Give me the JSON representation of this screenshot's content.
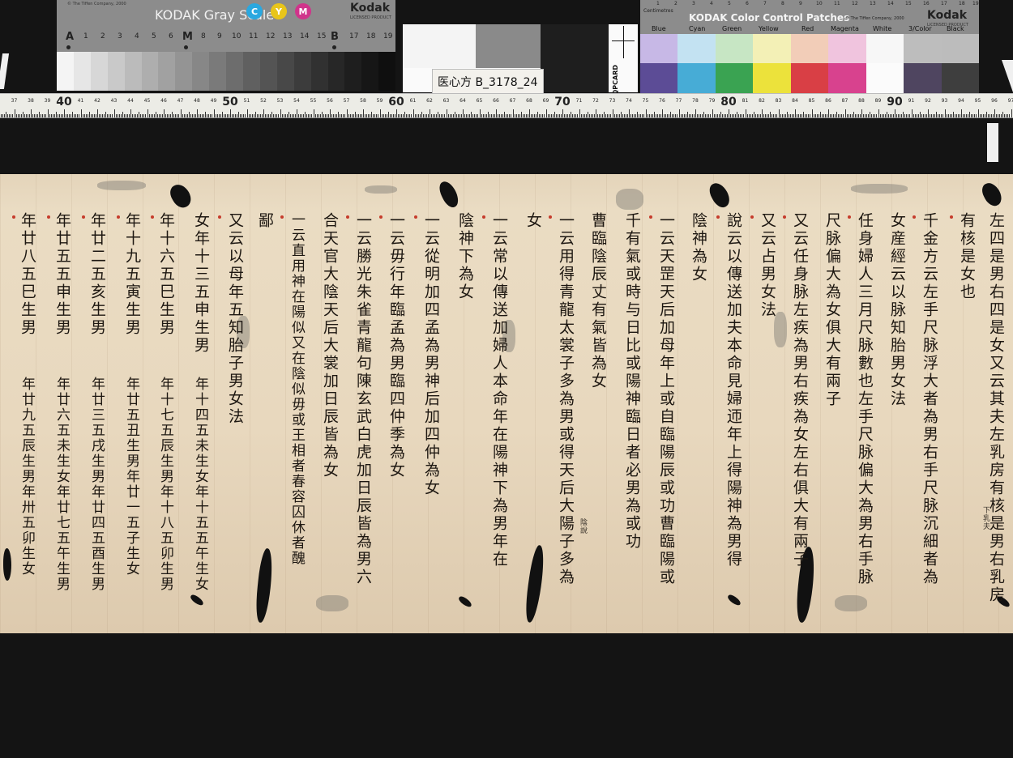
{
  "gray_card": {
    "copyright": "© The Tiffen Company, 2000",
    "title": "KODAK Gray Scale",
    "cym": [
      "C",
      "Y",
      "M"
    ],
    "brand": "Kodak",
    "brand_sub": "LICENSED PRODUCT",
    "scale": [
      "A",
      "1",
      "2",
      "3",
      "4",
      "5",
      "6",
      "M",
      "8",
      "9",
      "10",
      "11",
      "12",
      "13",
      "14",
      "15",
      "B",
      "17",
      "18",
      "19"
    ]
  },
  "label_card": {
    "label": "医心方 B_3178_24",
    "qpcard": "QPCARD"
  },
  "color_card": {
    "cm_label": "Centimetres",
    "cm_ticks": [
      "1",
      "2",
      "3",
      "4",
      "5",
      "6",
      "7",
      "8",
      "9",
      "10",
      "11",
      "12",
      "13",
      "14",
      "15",
      "16",
      "17",
      "18",
      "19"
    ],
    "title": "KODAK Color Control Patches",
    "copyright": "© The Tiffen Company, 2000",
    "brand": "Kodak",
    "brand_sub": "LICENSED PRODUCT",
    "patch_names": [
      "Blue",
      "Cyan",
      "Green",
      "Yellow",
      "Red",
      "Magenta",
      "White",
      "3/Color",
      "Black"
    ],
    "top_colors": [
      "#c7b8e6",
      "#c3e2f2",
      "#c7e6c4",
      "#f3f0b6",
      "#f2cdb8",
      "#f0c4de",
      "#f7f7f7",
      "#bdbdbd",
      "#bcbcbc"
    ],
    "bottom_colors": [
      "#5c4c96",
      "#47acd6",
      "#3aa352",
      "#ece23b",
      "#d93f45",
      "#d8428e",
      "#fbfbfb",
      "#4f4560",
      "#3e3e3e"
    ]
  },
  "ruler": {
    "major_labels": [
      "40",
      "50",
      "60",
      "70",
      "80",
      "90"
    ]
  },
  "columns": {
    "c1": "左四是男右四是女又云其夫左乳房有核是男右乳房",
    "c1_note": "下乳夫",
    "c2": "有核是女也",
    "c3": "千金方云左手尺脉浮大者為男右手尺脉沉細者為",
    "c4": "女産經云以脉知胎男女法",
    "c5": "任身婦人三月尺脉數也左手尺脉偏大為男右手脉",
    "c6": "尺脉偏大為女俱大有兩子",
    "c7": "又云任身脉左疾為男右疾為女左右俱大有兩子",
    "c8": "又云占男女法",
    "c9": "說云以傳送加夫本命見婦迊年上得陽神為男得",
    "c10": "陰神為女",
    "c11": "一云天罡天后加母年上或自臨陽辰或功曹臨陽或",
    "c12": "千有氣或時与日比或陽神臨日者必男為或功",
    "c13": "曹臨陰辰丈有氣皆為女",
    "c14": "一云用得青龍太裳子多為男或得天后大陽子多為",
    "c14_note": "陰說",
    "c15": "女",
    "c16": "一云常以傳送加婦人本命年在陽神下為男年在",
    "c17": "陰神下為女",
    "c18": "一云從明加四孟為男神后加四仲為女",
    "c19": "一云毋行年臨孟為男臨四仲季為女",
    "c20": "一云勝光朱雀青龍句陳玄武白虎加日辰皆為男六",
    "c21": "合天官大陰天后大裳加日辰皆為女",
    "c22": "一云直用神在陽似又在陰似毋或王相者春容囚休者醜",
    "c23": "鄙",
    "c24": "又云以母年五知胎子男女法",
    "c25_top": "女年十三五申生男",
    "c25_bot": "年十四五未生女年十五五午生女",
    "c26_top": "年十六五巳生男",
    "c26_bot": "年十七五辰生男年十八五卯生男",
    "c27_top": "年十九五寅生男",
    "c27_bot": "年廿五丑生男年廿一五子生女",
    "c28_top": "年廿二五亥生男",
    "c28_bot": "年廿三五戌生男年廿四五酉生男",
    "c29_top": "年廿五五申生男",
    "c29_bot": "年廿六五未生女年廿七五午生男",
    "c30_top": "年廿八五巳生男",
    "c30_bot": "年廿九五辰生男年卅五卯生女"
  }
}
